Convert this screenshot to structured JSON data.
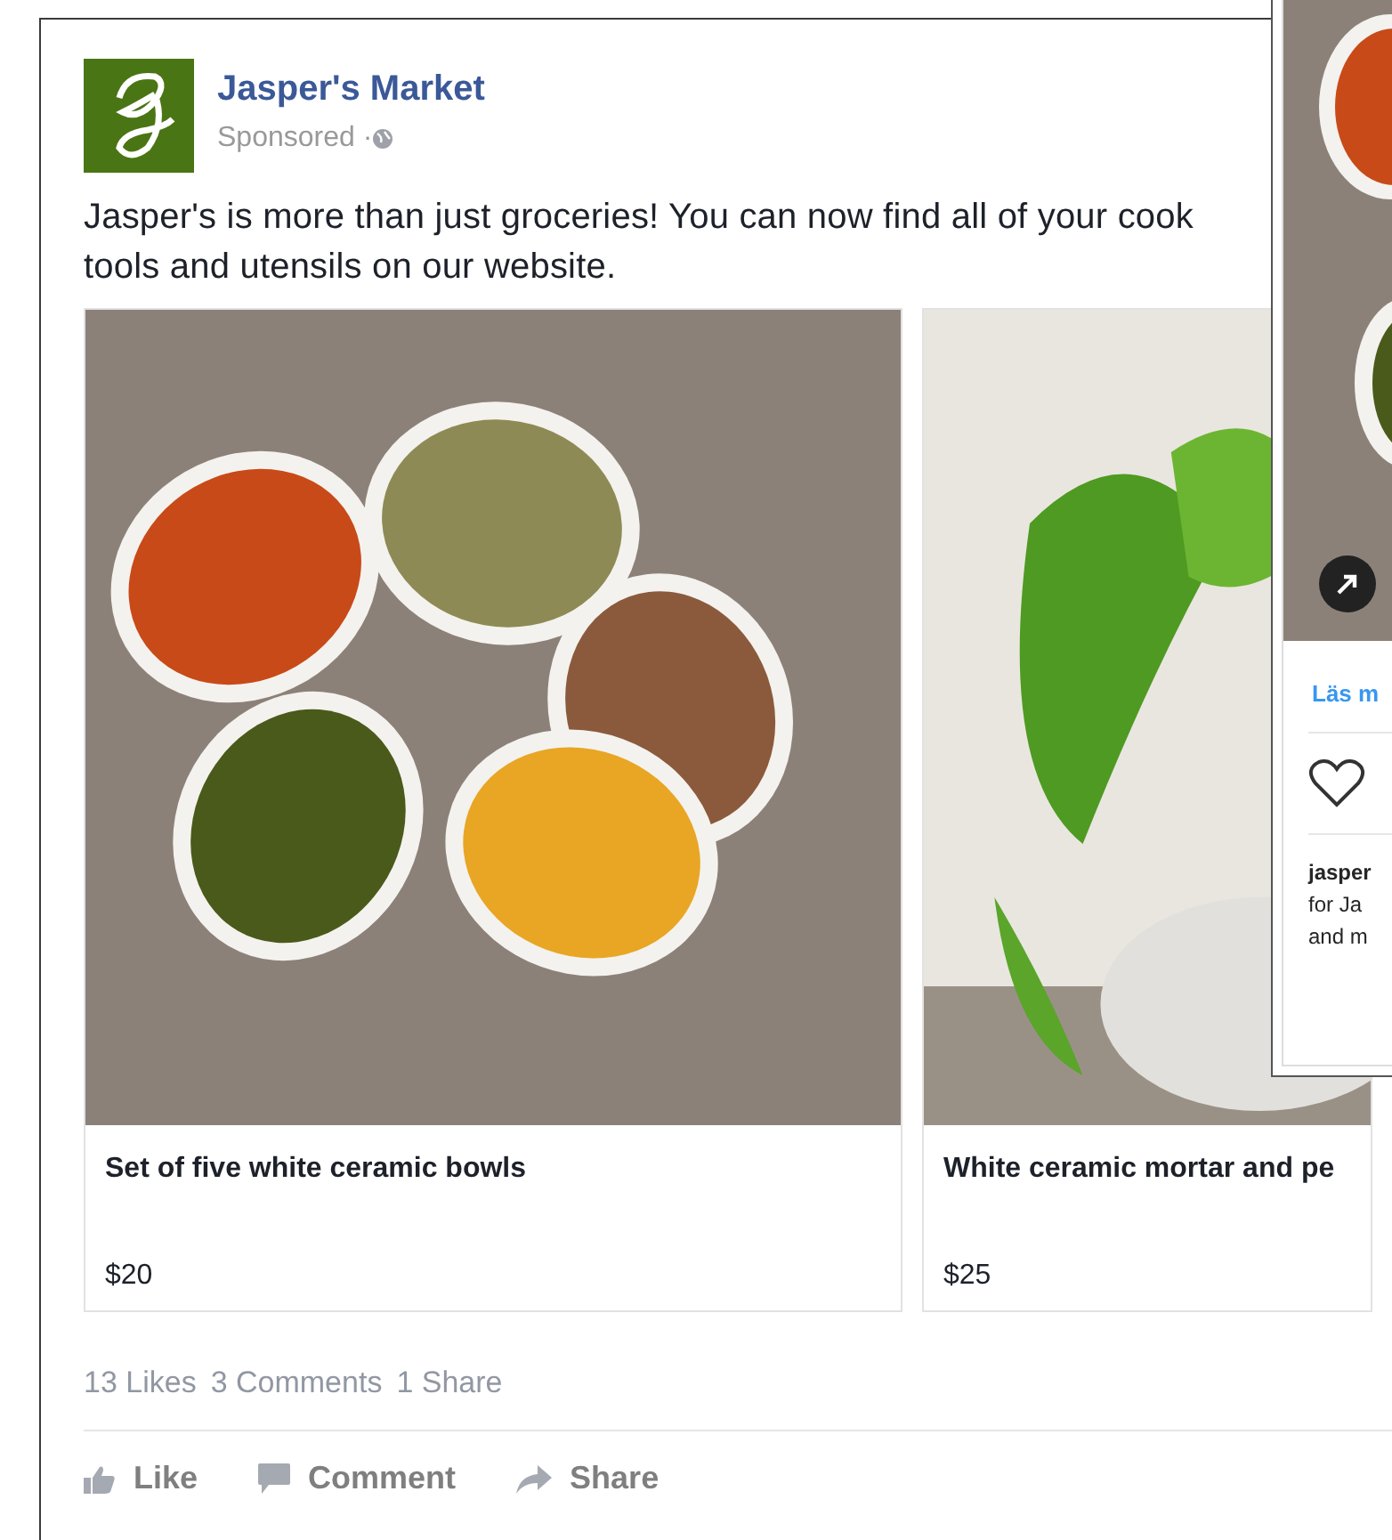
{
  "post": {
    "page_name": "Jasper's Market",
    "sponsored": "Sponsored · ",
    "text_lines": [
      "Jasper's is more than just groceries! You can now find all of your cook",
      "tools and utensils on our website."
    ],
    "products": [
      {
        "title": "Set of five white ceramic bowls",
        "price": "$20",
        "kind": "spices"
      },
      {
        "title": "White ceramic mortar and pe",
        "price": "$25",
        "kind": "herbs"
      }
    ],
    "stats": [
      "13 Likes",
      "3 Comments",
      "1 Share"
    ],
    "actions": [
      {
        "kind": "like",
        "label": "Like"
      },
      {
        "kind": "comment",
        "label": "Comment"
      },
      {
        "kind": "share",
        "label": "Share"
      }
    ]
  },
  "overlay": {
    "link": "Läs m",
    "caption_user": "jasper",
    "caption_lines": [
      "for Ja",
      "and m"
    ]
  }
}
